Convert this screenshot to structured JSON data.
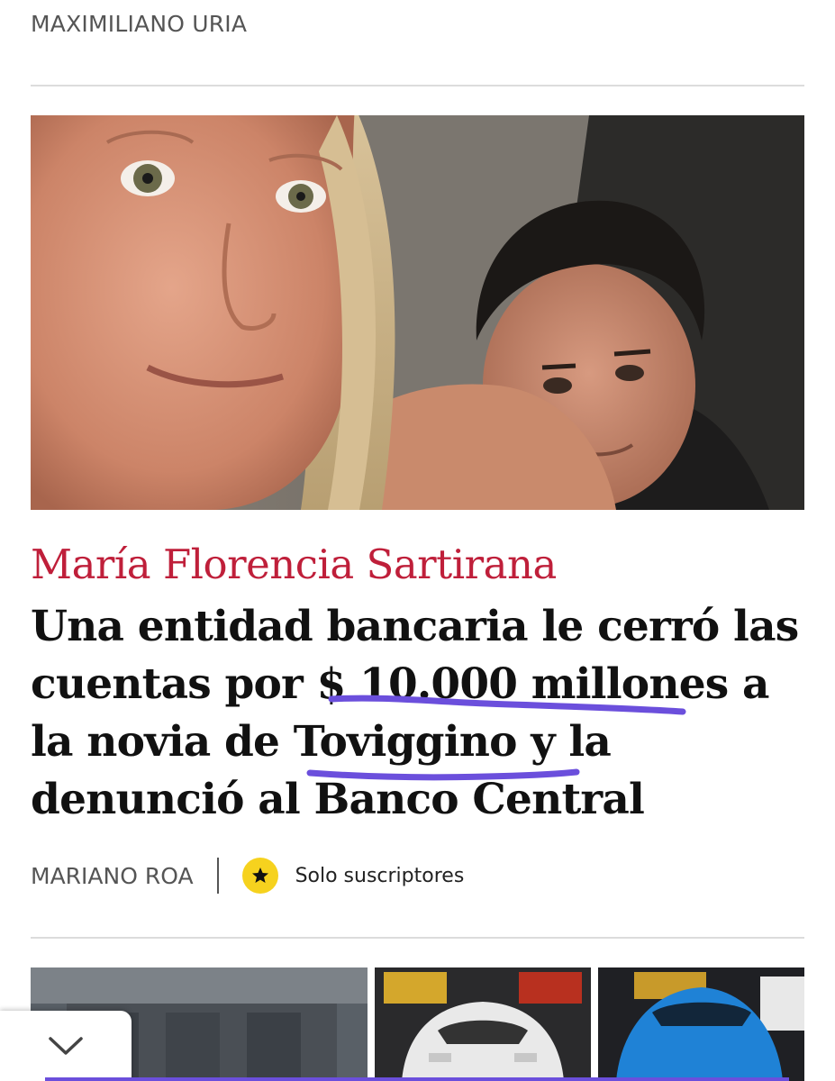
{
  "section_author": "MAXIMILIANO URIA",
  "hero_image": {
    "description_icon": "photo"
  },
  "article": {
    "kicker": "María Florencia Sartirana",
    "headline_lines": [
      "Una entidad bancaria le cerró las",
      "cuentas por $ 10.000 millones a",
      "la novia de Toviggino y la",
      "denunció al Banco Central"
    ],
    "byline_author": "MARIANO ROA",
    "subscribers_label": "Solo suscriptores"
  },
  "colors": {
    "kicker": "#bf1f3a",
    "badge": "#f6d21e",
    "annotation": "#6b4fdc"
  }
}
